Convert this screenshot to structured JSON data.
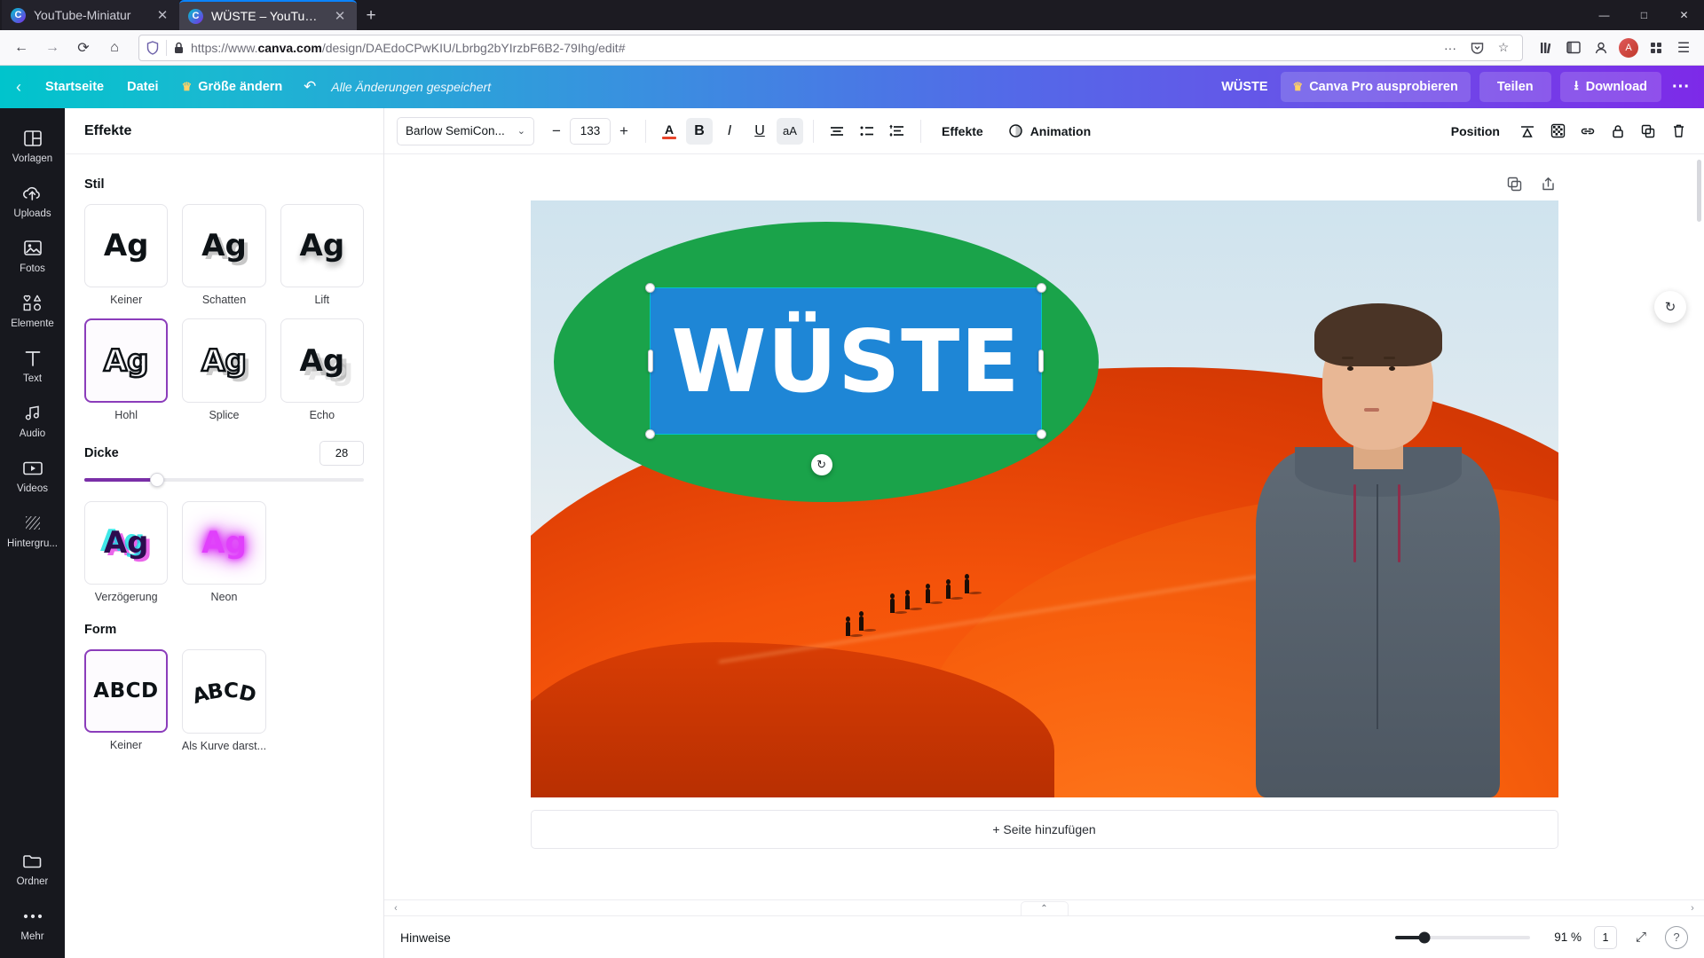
{
  "browser": {
    "tabs": [
      {
        "title": "YouTube-Miniatur",
        "active": false
      },
      {
        "title": "WÜSTE – YouTube-Miniatur",
        "active": true
      }
    ],
    "new_tab_label": "+",
    "window_controls": {
      "minimize": "—",
      "maximize": "□",
      "close": "✕"
    },
    "nav": {
      "back": "←",
      "forward": "→",
      "reload": "⟳",
      "home": "⌂"
    },
    "url": {
      "prefix": "https://www.",
      "domain": "canva.com",
      "path": "/design/DAEdoCPwKIU/Lbrbg2bYIrzbF6B2-79Ihg/edit#"
    },
    "url_icons": {
      "shield": "shield-icon",
      "lock": "lock-icon",
      "more": "···",
      "pocket": "pocket-icon",
      "star": "☆"
    },
    "toolbar_right": {
      "library": "library-icon",
      "sidebar": "sidebar-icon",
      "account": "account-icon",
      "avatar": "A",
      "extensions": "extensions-icon",
      "menu": "☰"
    }
  },
  "header": {
    "back_icon": "‹",
    "home_label": "Startseite",
    "file_label": "Datei",
    "resize_label": "Größe ändern",
    "resize_crown": "♛",
    "undo_icon": "↶",
    "saved_label": "Alle Änderungen gespeichert",
    "doc_name": "WÜSTE",
    "pro_label": "Canva Pro ausprobieren",
    "pro_crown": "♛",
    "share_label": "Teilen",
    "download_label": "Download",
    "download_icon": "⭳",
    "more_label": "···"
  },
  "rail": {
    "items": [
      {
        "label": "Vorlagen",
        "icon": "templates-icon"
      },
      {
        "label": "Uploads",
        "icon": "upload-cloud-icon"
      },
      {
        "label": "Fotos",
        "icon": "photo-icon"
      },
      {
        "label": "Elemente",
        "icon": "elements-icon"
      },
      {
        "label": "Text",
        "icon": "text-icon"
      },
      {
        "label": "Audio",
        "icon": "audio-icon"
      },
      {
        "label": "Videos",
        "icon": "video-icon"
      },
      {
        "label": "Hintergru...",
        "icon": "background-icon"
      },
      {
        "label": "Ordner",
        "icon": "folder-icon"
      },
      {
        "label": "Mehr",
        "icon": "more-dots-icon"
      }
    ]
  },
  "panel": {
    "title": "Effekte",
    "style_section": "Stil",
    "styles": [
      {
        "label": "Keiner",
        "sample": "Ag",
        "fx": "none",
        "selected": false
      },
      {
        "label": "Schatten",
        "sample": "Ag",
        "fx": "shadow",
        "selected": false
      },
      {
        "label": "Lift",
        "sample": "Ag",
        "fx": "lift",
        "selected": false
      },
      {
        "label": "Hohl",
        "sample": "Ag",
        "fx": "hollow",
        "selected": true
      },
      {
        "label": "Splice",
        "sample": "Ag",
        "fx": "splice",
        "selected": false
      },
      {
        "label": "Echo",
        "sample": "Ag",
        "fx": "echo",
        "selected": false
      },
      {
        "label": "Verzögerung",
        "sample": "Ag",
        "fx": "glitch",
        "selected": false
      },
      {
        "label": "Neon",
        "sample": "Ag",
        "fx": "neon",
        "selected": false
      }
    ],
    "thickness": {
      "label": "Dicke",
      "value": "28",
      "percent": 26
    },
    "shape_section": "Form",
    "shapes": [
      {
        "label": "Keiner",
        "sample": "ABCD",
        "selected": true
      },
      {
        "label": "Als Kurve darst...",
        "sample": "ABCD",
        "selected": false
      }
    ]
  },
  "toolbar": {
    "font_name": "Barlow SemiCon...",
    "font_caret": "⌄",
    "size_minus": "−",
    "size_value": "133",
    "size_plus": "+",
    "text_color_icon": "A",
    "bold_label": "B",
    "italic_label": "I",
    "underline_label": "U",
    "case_label": "aA",
    "align_icon": "align-icon",
    "list_icon": "list-icon",
    "spacing_icon": "spacing-icon",
    "effects_label": "Effekte",
    "animation_label": "Animation",
    "animation_icon": "animation-icon",
    "position_label": "Position",
    "transparency_icon": "transparency-icon",
    "pattern_icon": "pattern-icon",
    "link_icon": "link-icon",
    "lock_icon": "lock-icon",
    "duplicate_icon": "duplicate-icon",
    "delete_icon": "trash-icon"
  },
  "canvas": {
    "page_tools": {
      "duplicate": "duplicate-icon",
      "share": "share-icon"
    },
    "design_text": "WÜSTE",
    "text_color": "#ffffff",
    "textbox_color": "#1e86d6",
    "ellipse_color": "#1aa34a",
    "rotate_icon": "↻",
    "add_page_label": "+ Seite hinzufügen",
    "refresh_icon": "↻"
  },
  "status": {
    "notes_label": "Hinweise",
    "zoom_percent": "91 %",
    "page_count": "1",
    "expand_icon": "⤢",
    "help_icon": "?",
    "caret_icon": "⌃"
  }
}
